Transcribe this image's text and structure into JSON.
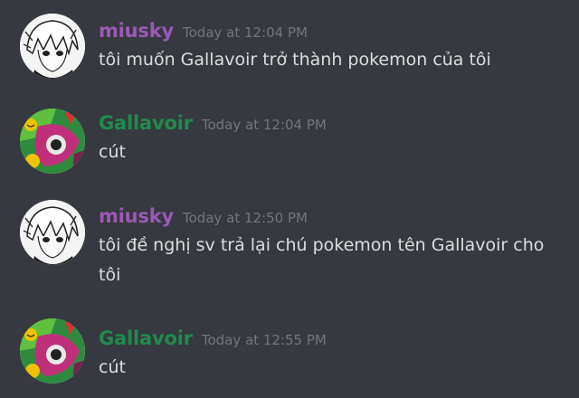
{
  "colors": {
    "background": "#36393f",
    "miusky_name": "#9b59b6",
    "gallavoir_name": "#1f8b4c",
    "timestamp": "#72767d",
    "text": "#dcddde"
  },
  "messages": [
    {
      "author": "miusky",
      "timestamp": "Today at 12:04 PM",
      "text": "tôi muốn Gallavoir trở thành pokemon của tôi",
      "avatar_icon": "anime-character-avatar-icon"
    },
    {
      "author": "Gallavoir",
      "timestamp": "Today at 12:04 PM",
      "text": "cút",
      "avatar_icon": "pokemon-collage-avatar-icon"
    },
    {
      "author": "miusky",
      "timestamp": "Today at 12:50 PM",
      "text": "tôi đề nghị sv trả lại chú pokemon tên Gallavoir cho tôi",
      "avatar_icon": "anime-character-avatar-icon"
    },
    {
      "author": "Gallavoir",
      "timestamp": "Today at 12:55 PM",
      "text": "cút",
      "avatar_icon": "pokemon-collage-avatar-icon"
    }
  ]
}
